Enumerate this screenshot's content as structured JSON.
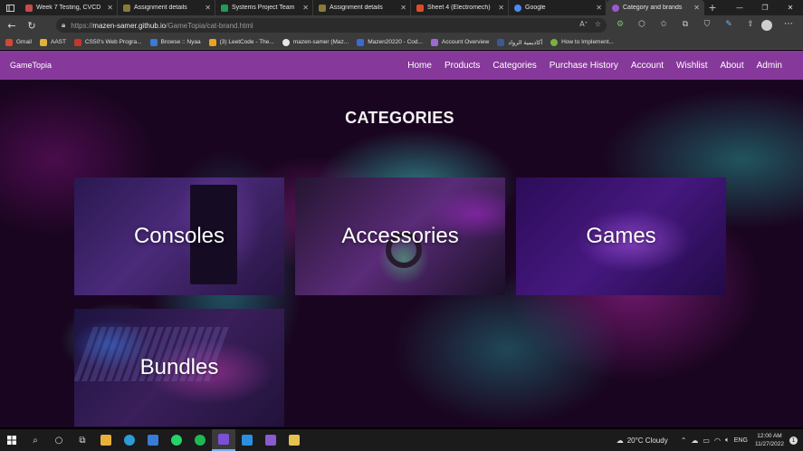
{
  "browser": {
    "tabs": [
      {
        "title": "Week 7 Testing, CVCD",
        "favicon_color": "#c94a4a",
        "active": false
      },
      {
        "title": "Assignment details",
        "favicon_color": "#8a7a3a",
        "active": false
      },
      {
        "title": "Systems Project Team",
        "favicon_color": "#1f9d55",
        "active": false
      },
      {
        "title": "Assignment details",
        "favicon_color": "#8a7a3a",
        "active": false
      },
      {
        "title": "Sheet 4 (Electromech)",
        "favicon_color": "#e04a2a",
        "active": false
      },
      {
        "title": "Google",
        "favicon_color": "#4a8af4",
        "active": false
      },
      {
        "title": "Category and brands",
        "favicon_color": "#9b5ad0",
        "active": true
      }
    ],
    "new_tab_label": "+",
    "url_prefix": "https://",
    "url_host": "mazen-samer.github.io",
    "url_path": "/GameTopia/cat-brand.html",
    "bookmarks": [
      {
        "label": "Gmail",
        "color": "#d44638"
      },
      {
        "label": "AAST",
        "color": "#e0b040"
      },
      {
        "label": "CS50's Web Progra...",
        "color": "#c0392b"
      },
      {
        "label": "Browse :: Nyaa",
        "color": "#3a7bd5"
      },
      {
        "label": "(3) LeetCode - The...",
        "color": "#f0a020"
      },
      {
        "label": "mazen-samer (Maz...",
        "color": "#e6e6e6"
      },
      {
        "label": "Mazen20220 - Cod...",
        "color": "#3a6ad5"
      },
      {
        "label": "Account Overview",
        "color": "#9a6ad5"
      },
      {
        "label": "أكاديمية الرواد",
        "color": "#3a5a95"
      },
      {
        "label": "How to Implement...",
        "color": "#7ab040"
      }
    ]
  },
  "site": {
    "brand": "GameTopia",
    "nav": [
      "Home",
      "Products",
      "Categories",
      "Purchase History",
      "Account",
      "Wishlist",
      "About",
      "Admin"
    ],
    "heading": "CATEGORIES",
    "categories": [
      {
        "label": "Consoles"
      },
      {
        "label": "Accessories"
      },
      {
        "label": "Games"
      },
      {
        "label": "Bundles"
      }
    ]
  },
  "taskbar": {
    "weather": "20°C  Cloudy",
    "lang": "ENG",
    "time": "12:00 AM",
    "date": "11/27/2022",
    "notifications": "1"
  }
}
